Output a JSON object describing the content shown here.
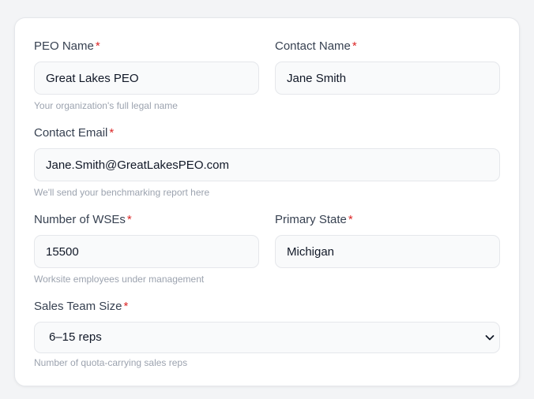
{
  "form": {
    "peo_name": {
      "label": "PEO Name",
      "required": "*",
      "value": "Great Lakes PEO",
      "help": "Your organization's full legal name"
    },
    "contact_name": {
      "label": "Contact Name",
      "required": "*",
      "value": "Jane Smith"
    },
    "contact_email": {
      "label": "Contact Email",
      "required": "*",
      "value": "Jane.Smith@GreatLakesPEO.com",
      "help": "We'll send your benchmarking report here"
    },
    "num_wses": {
      "label": "Number of WSEs",
      "required": "*",
      "value": "15500",
      "help": "Worksite employees under management"
    },
    "primary_state": {
      "label": "Primary State",
      "required": "*",
      "value": "Michigan"
    },
    "sales_team_size": {
      "label": "Sales Team Size",
      "required": "*",
      "selected": "6–15 reps",
      "help": "Number of quota-carrying sales reps"
    }
  },
  "colors": {
    "required_marker": "#dc2626",
    "input_bg": "#f9fafb",
    "border": "#e5e7eb",
    "help_text": "#9ca3af"
  },
  "icons": {
    "select_chevron": "chevron-down-icon"
  }
}
